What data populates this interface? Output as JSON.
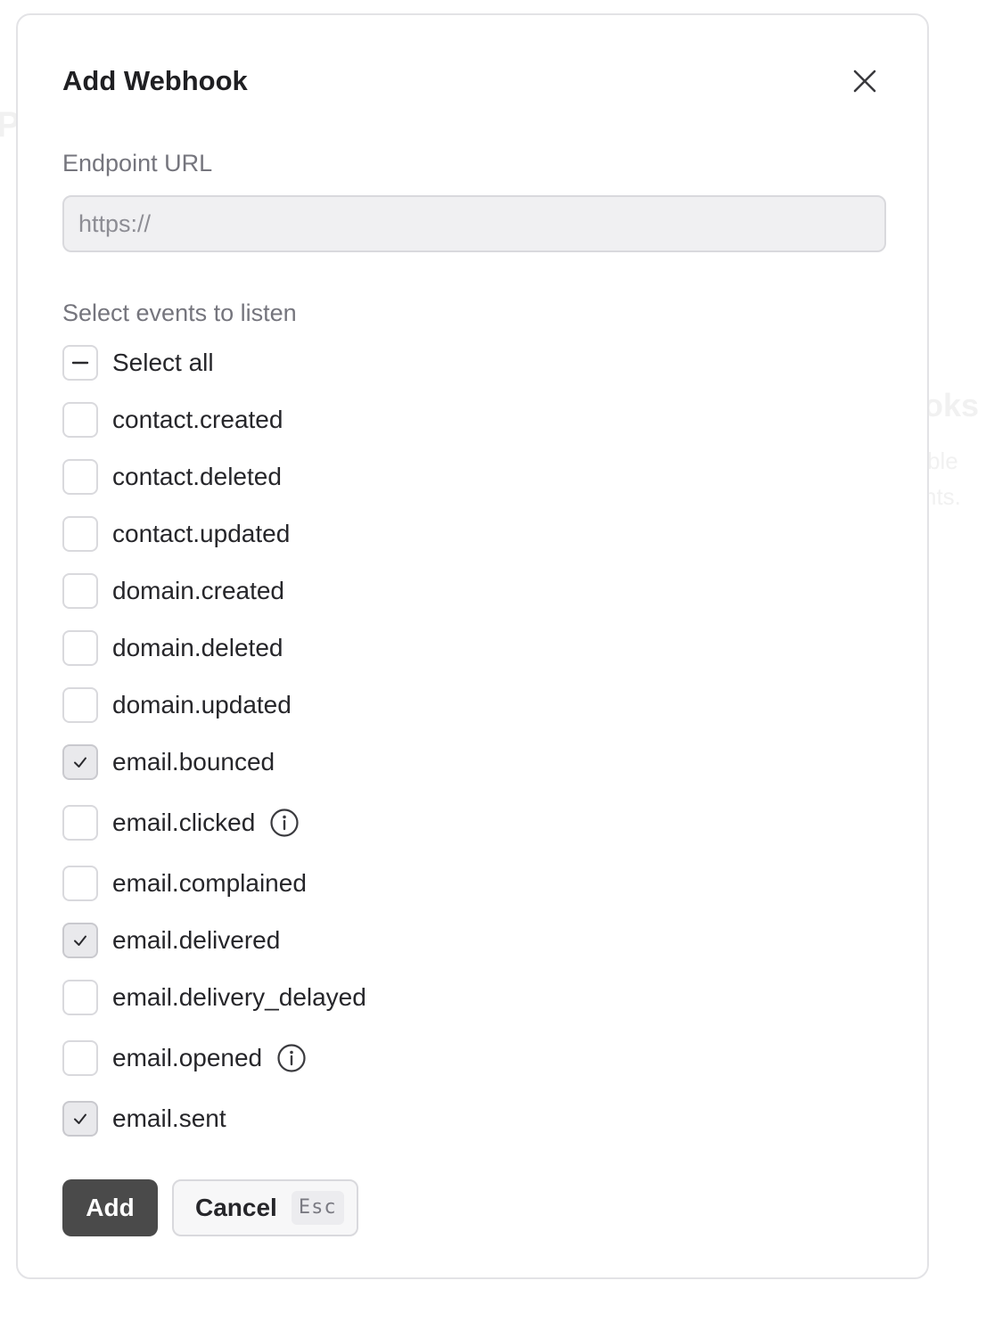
{
  "background": {
    "fragments": [
      "P",
      "oks",
      "ble",
      "nts."
    ]
  },
  "modal": {
    "title": "Add Webhook",
    "close_icon": "close-icon",
    "endpoint": {
      "label": "Endpoint URL",
      "value": "",
      "placeholder": "https://"
    },
    "events_label": "Select events to listen",
    "select_all": {
      "label": "Select all",
      "state": "indeterminate"
    },
    "events": [
      {
        "label": "contact.created",
        "checked": false,
        "info": false
      },
      {
        "label": "contact.deleted",
        "checked": false,
        "info": false
      },
      {
        "label": "contact.updated",
        "checked": false,
        "info": false
      },
      {
        "label": "domain.created",
        "checked": false,
        "info": false
      },
      {
        "label": "domain.deleted",
        "checked": false,
        "info": false
      },
      {
        "label": "domain.updated",
        "checked": false,
        "info": false
      },
      {
        "label": "email.bounced",
        "checked": true,
        "info": false
      },
      {
        "label": "email.clicked",
        "checked": false,
        "info": true
      },
      {
        "label": "email.complained",
        "checked": false,
        "info": false
      },
      {
        "label": "email.delivered",
        "checked": true,
        "info": false
      },
      {
        "label": "email.delivery_delayed",
        "checked": false,
        "info": false
      },
      {
        "label": "email.opened",
        "checked": false,
        "info": true
      },
      {
        "label": "email.sent",
        "checked": true,
        "info": false
      }
    ],
    "actions": {
      "add_label": "Add",
      "cancel_label": "Cancel",
      "cancel_shortcut": "Esc"
    },
    "colors": {
      "primary_button": "#4a4a4a",
      "checked_box": "#e9e9ec",
      "input_background": "#f0f0f2"
    }
  }
}
